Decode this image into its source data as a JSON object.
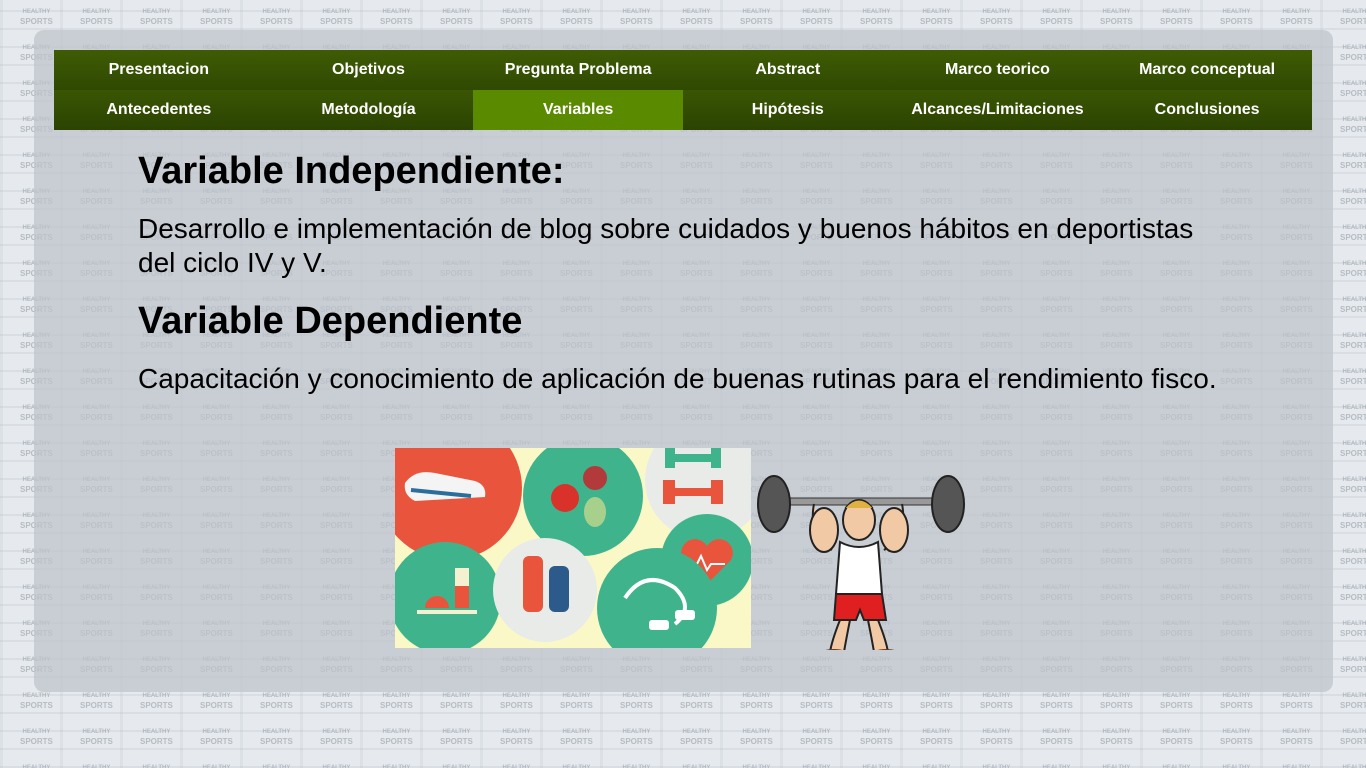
{
  "nav": {
    "row1": [
      "Presentacion",
      "Objetivos",
      "Pregunta Problema",
      "Abstract",
      "Marco teorico",
      "Marco conceptual"
    ],
    "row2": [
      "Antecedentes",
      "Metodología",
      "Variables",
      "Hipótesis",
      "Alcances/Limitaciones",
      "Conclusiones"
    ],
    "active": "Variables"
  },
  "content": {
    "independent_heading": "Variable Independiente:",
    "independent_text": "Desarrollo e implementación de blog sobre cuidados y buenos hábitos en deportistas del ciclo IV y V.",
    "dependent_heading": "Variable Dependiente",
    "dependent_text": "Capacitación y conocimiento de aplicación de buenas rutinas para el rendimiento fisco."
  },
  "images": {
    "fitness_icons": "fitness-illustration",
    "weightlifter": "weightlifter-cartoon"
  },
  "watermark": {
    "line1": "HEALTHY",
    "line2": "SPORTS"
  },
  "colors": {
    "nav_dark": "#3a5603",
    "nav_active": "#5a8a00",
    "panel": "#bec4ca"
  }
}
